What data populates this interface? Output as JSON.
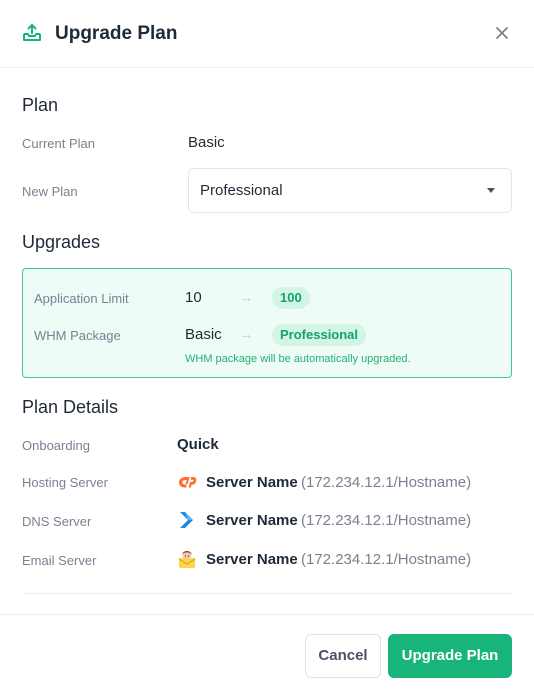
{
  "header": {
    "title": "Upgrade Plan",
    "icon": "upgrade-tray-icon"
  },
  "plan": {
    "section_title": "Plan",
    "current_plan_label": "Current Plan",
    "current_plan_value": "Basic",
    "new_plan_label": "New Plan",
    "new_plan_value": "Professional"
  },
  "upgrades": {
    "section_title": "Upgrades",
    "items": [
      {
        "label": "Application Limit",
        "from": "10",
        "arrow": "→",
        "to": "100"
      },
      {
        "label": "WHM Package",
        "from": "Basic",
        "arrow": "→",
        "to": "Professional"
      }
    ],
    "note": "WHM package will be automatically upgraded."
  },
  "details": {
    "section_title": "Plan Details",
    "onboarding_label": "Onboarding",
    "onboarding_value": "Quick",
    "servers": [
      {
        "label": "Hosting Server",
        "name": "Server Name",
        "host": "(172.234.12.1/Hostname)",
        "icon": "cpanel-icon"
      },
      {
        "label": "DNS Server",
        "name": "Server Name",
        "host": "(172.234.12.1/Hostname)",
        "icon": "dns-chevron-icon"
      },
      {
        "label": "Email Server",
        "name": "Server Name",
        "host": "(172.234.12.1/Hostname)",
        "icon": "email-server-icon"
      }
    ]
  },
  "footer": {
    "cancel_label": "Cancel",
    "submit_label": "Upgrade Plan"
  },
  "colors": {
    "accent": "#18b57a",
    "accent_bg": "#effbf6",
    "pill_bg": "#d3f5e5",
    "cpanel": "#ff6c2c",
    "dns": "#1e88e5"
  }
}
